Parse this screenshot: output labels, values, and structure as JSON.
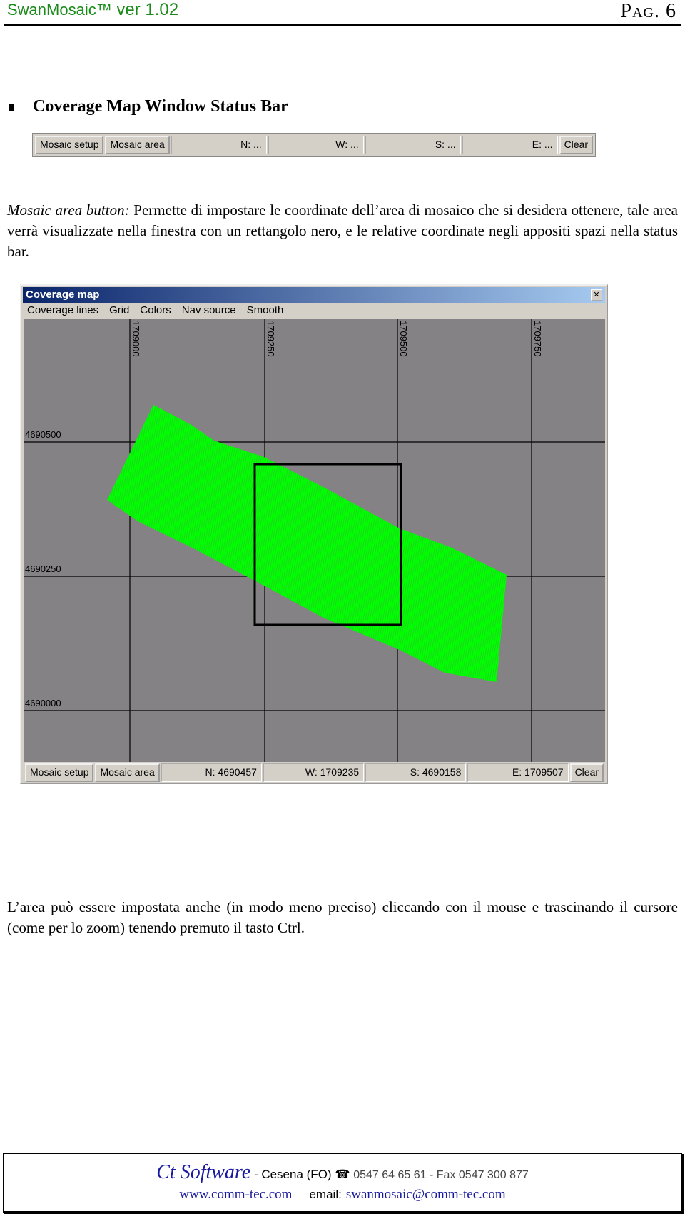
{
  "header": {
    "product": "SwanMosaic™",
    "version": "ver 1.02",
    "page": "Pag. 6"
  },
  "section_title": "Coverage Map Window Status Bar",
  "statusbar_empty": {
    "mosaic_setup": "Mosaic setup",
    "mosaic_area": "Mosaic area",
    "n": "N: ...",
    "w": "W: ...",
    "s": "S: ...",
    "e": "E: ...",
    "clear": "Clear"
  },
  "para1_label": "Mosaic area button:",
  "para1": " Permette di impostare le coordinate dell’area di mosaico che si desidera ottenere, tale area verrà visualizzate nella finestra con un rettangolo nero, e le relative coordinate negli appositi spazi nella status bar.",
  "window": {
    "title": "Coverage map",
    "close_icon": "close-icon",
    "menu": [
      "Coverage lines",
      "Grid",
      "Colors",
      "Nav source",
      "Smooth"
    ],
    "x_labels": [
      "1709000",
      "1709250",
      "1709500",
      "1709750"
    ],
    "y_labels": [
      "4690500",
      "4690250",
      "4690000"
    ],
    "coverage_color": "#00ff00",
    "map_bg": "#848284",
    "statusbar": {
      "mosaic_setup": "Mosaic setup",
      "mosaic_area": "Mosaic area",
      "n": "N: 4690457",
      "w": "W: 1709235",
      "s": "S: 4690158",
      "e": "E: 1709507",
      "clear": "Clear"
    }
  },
  "para2": "L’area può essere impostata anche (in modo meno preciso) cliccando con il mouse e trascinando il cursore (come per lo zoom) tenendo premuto il tasto Ctrl.",
  "footer": {
    "brand": "Ct Software",
    "city": " - Cesena (FO) ",
    "phone_icon": "phone-icon",
    "phone": "0547 64 65 61 - Fax 0547 300 877",
    "website": "www.comm-tec.com",
    "email_label": "email:",
    "email": "swanmosaic@comm-tec.com"
  }
}
